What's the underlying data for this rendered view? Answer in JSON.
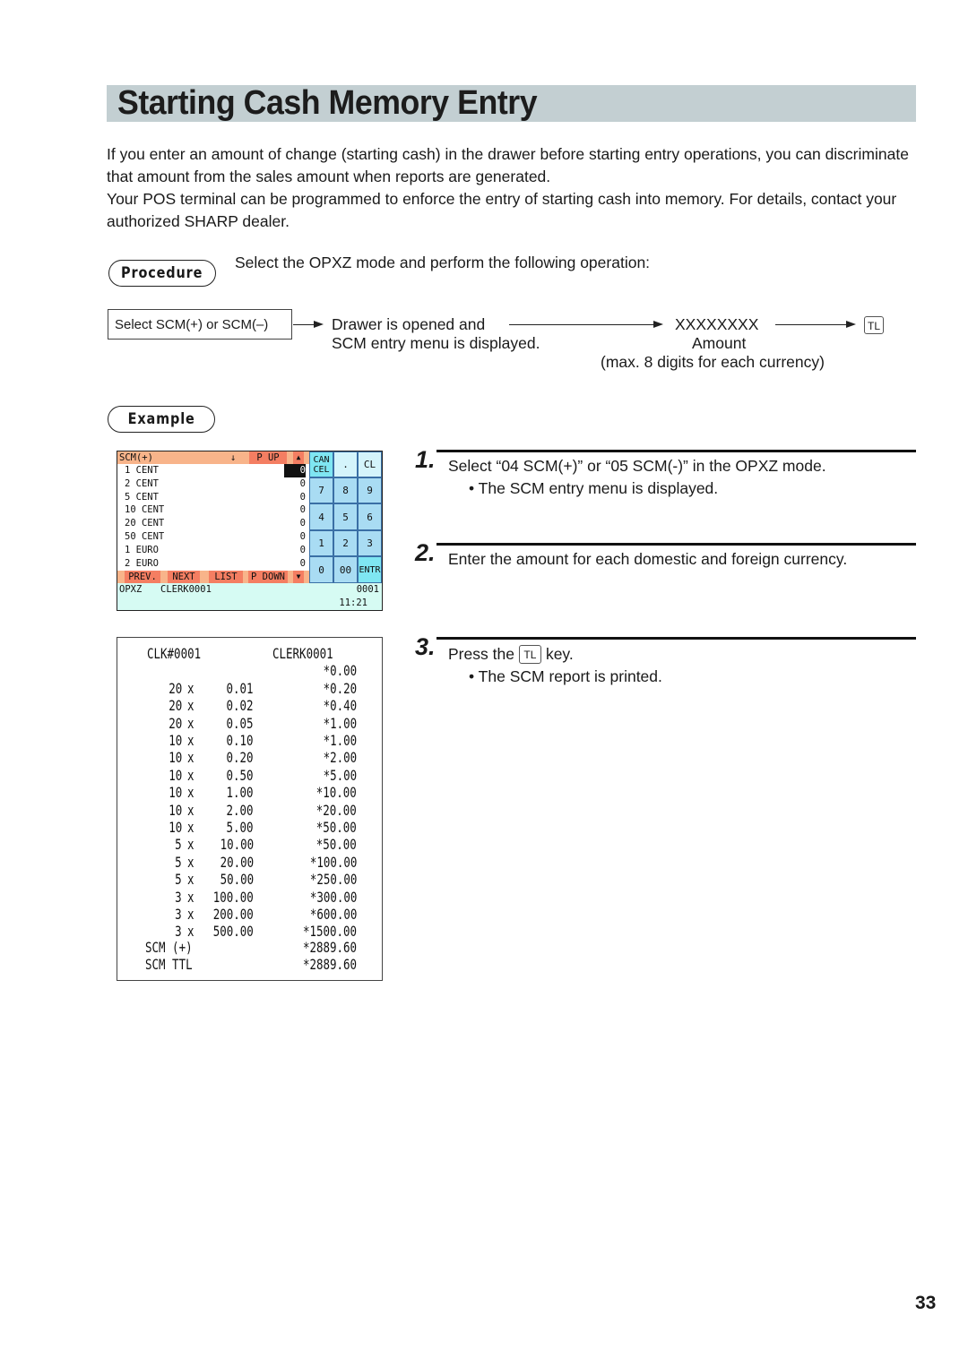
{
  "title": "Starting Cash Memory Entry",
  "intro": [
    "If you enter an amount of change (starting cash) in the drawer before starting entry operations, you can discriminate that amount from the sales amount when reports are generated.",
    "Your POS terminal can be programmed to enforce the entry of starting cash into memory. For details, contact your authorized SHARP dealer."
  ],
  "procedure": {
    "badge": "Procedure",
    "instruction": "Select the OPXZ mode and perform the following operation:",
    "flow": {
      "start_box": "Select SCM(+) or SCM(–)",
      "step2_line1": "Drawer is opened and",
      "step2_line2": "SCM entry menu is displayed.",
      "amount_placeholder": "XXXXXXXX",
      "amount_label": "Amount",
      "amount_note": "(max. 8 digits for each currency)",
      "key": "TL"
    }
  },
  "example": {
    "badge": "Example",
    "pos_screen": {
      "header": {
        "title": "SCM(+)",
        "down_arrow": "↓",
        "page_up": "P UP",
        "up_triangle": "▲"
      },
      "rows": [
        {
          "label": "1 CENT",
          "value": "0"
        },
        {
          "label": "2 CENT",
          "value": "0"
        },
        {
          "label": "5 CENT",
          "value": "0"
        },
        {
          "label": "10 CENT",
          "value": "0"
        },
        {
          "label": "20 CENT",
          "value": "0"
        },
        {
          "label": "50 CENT",
          "value": "0"
        },
        {
          "label": "1 EURO",
          "value": "0"
        },
        {
          "label": "2 EURO",
          "value": "0"
        }
      ],
      "footer_buttons": [
        "PREV.",
        "NEXT",
        "LIST",
        "P DOWN",
        "▼"
      ],
      "keypad": {
        "cancel": "CAN CEL",
        "dot": ".",
        "clear": "CL",
        "digits": [
          "7",
          "8",
          "9",
          "4",
          "5",
          "6",
          "1",
          "2",
          "3",
          "0",
          "00"
        ],
        "enter": "ENTR"
      },
      "status": {
        "mode": "OPXZ",
        "clerk": "CLERK0001",
        "number": "0001",
        "time": "11:21"
      }
    },
    "receipt": {
      "clerk_no": "CLK#0001",
      "clerk_name": "CLERK0001",
      "opening": "*0.00",
      "lines": [
        {
          "qty": "20",
          "denom": "0.01",
          "amount": "*0.20"
        },
        {
          "qty": "20",
          "denom": "0.02",
          "amount": "*0.40"
        },
        {
          "qty": "20",
          "denom": "0.05",
          "amount": "*1.00"
        },
        {
          "qty": "10",
          "denom": "0.10",
          "amount": "*1.00"
        },
        {
          "qty": "10",
          "denom": "0.20",
          "amount": "*2.00"
        },
        {
          "qty": "10",
          "denom": "0.50",
          "amount": "*5.00"
        },
        {
          "qty": "10",
          "denom": "1.00",
          "amount": "*10.00"
        },
        {
          "qty": "10",
          "denom": "2.00",
          "amount": "*20.00"
        },
        {
          "qty": "10",
          "denom": "5.00",
          "amount": "*50.00"
        },
        {
          "qty": "5",
          "denom": "10.00",
          "amount": "*50.00"
        },
        {
          "qty": "5",
          "denom": "20.00",
          "amount": "*100.00"
        },
        {
          "qty": "5",
          "denom": "50.00",
          "amount": "*250.00"
        },
        {
          "qty": "3",
          "denom": "100.00",
          "amount": "*300.00"
        },
        {
          "qty": "3",
          "denom": "200.00",
          "amount": "*600.00"
        },
        {
          "qty": "3",
          "denom": "500.00",
          "amount": "*1500.00"
        }
      ],
      "times_symbol": "x",
      "totals": [
        {
          "label": "SCM (+)",
          "amount": "*2889.60"
        },
        {
          "label": "SCM TTL",
          "amount": "*2889.60"
        }
      ]
    },
    "steps": [
      {
        "number": "1.",
        "text": "Select “04 SCM(+)” or “05 SCM(-)” in the OPXZ mode.",
        "note": "• The SCM entry menu is displayed."
      },
      {
        "number": "2.",
        "text": "Enter the amount for each domestic and foreign currency.",
        "note": ""
      },
      {
        "number": "3.",
        "text_before": "Press the",
        "key": "TL",
        "text_after": "key.",
        "note": "• The SCM report is printed."
      }
    ]
  },
  "page_number": "33"
}
